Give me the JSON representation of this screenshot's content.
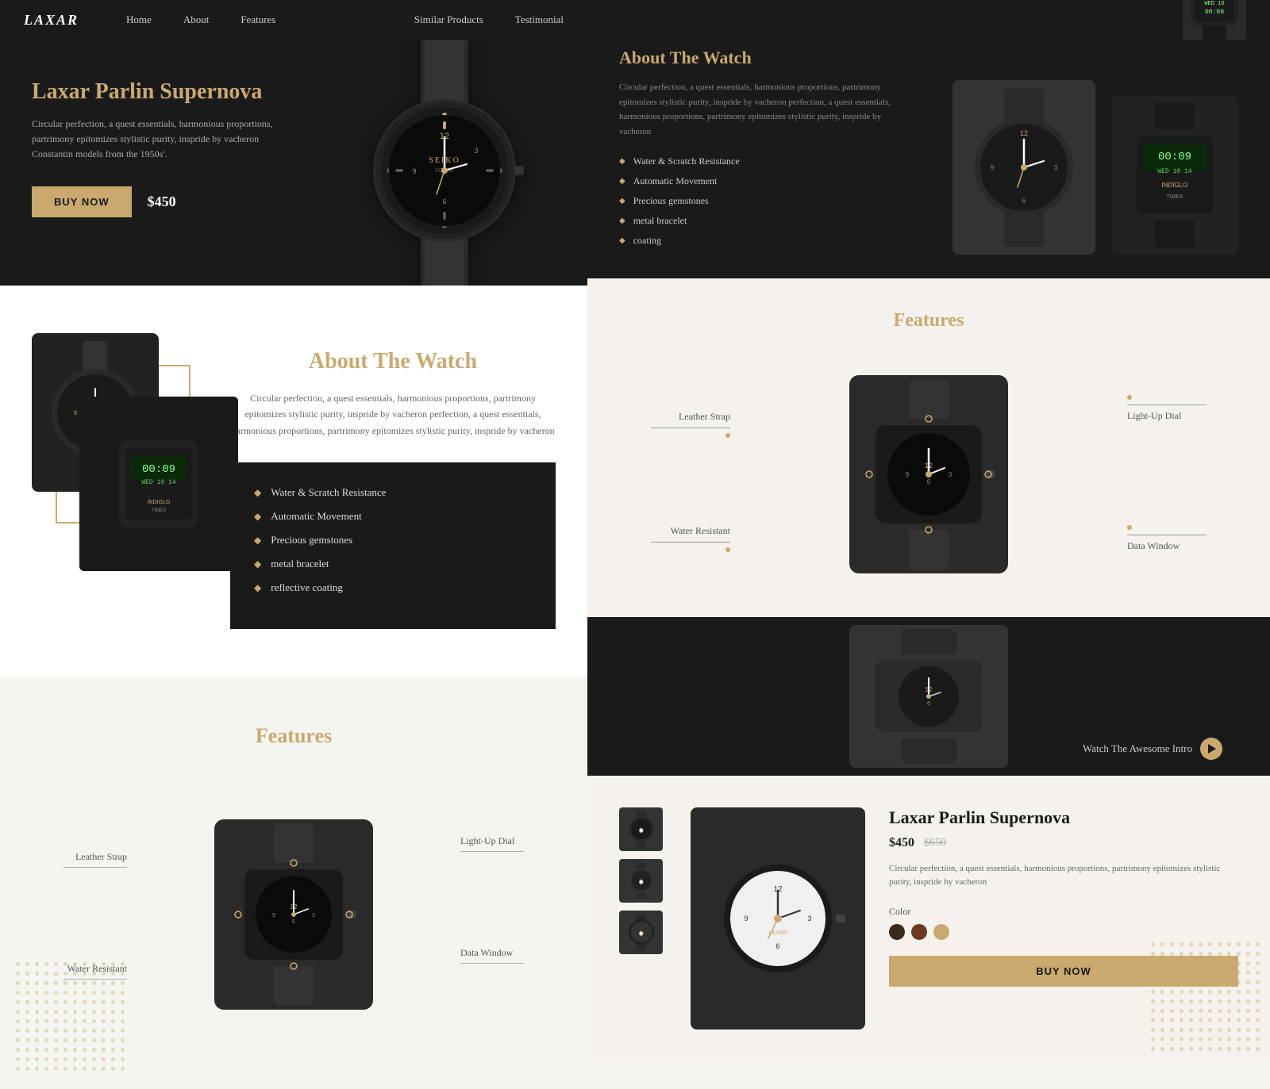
{
  "brand": {
    "name": "LA",
    "name_italic": "X",
    "name_rest": "AR"
  },
  "nav": {
    "links": [
      "Home",
      "About",
      "Features",
      "Similar Products",
      "Testimonial"
    ]
  },
  "hero": {
    "title": "Laxar Parlin Supernova",
    "description": "Circular perfection, a quest essentials, harmonious proportions, partrimony epitomizes stylistic purity, inspride by vacheron Constantin models from the 1950s'.",
    "buy_label": "BUY NOW",
    "price": "$450"
  },
  "about": {
    "title": "About The Watch",
    "description": "Circular perfection, a quest essentials, harmonious proportions, partrimony epitomizes stylistic purity, inspride by vacheron perfection, a quest essentials, harmonious proportions, partrimony epitomizes stylistic purity, inspride by vacheron"
  },
  "features_list": [
    "Water & Scratch Resistance",
    "Automatic Movement",
    "Precious gemstones",
    "metal bracelet",
    "reflective coating"
  ],
  "features": {
    "title": "Features",
    "labels": {
      "leather_strap": "Leather Strap",
      "light_up_dial": "Light-Up Dial",
      "water_resistant": "Water Resistant",
      "data_window": "Data Window"
    }
  },
  "right": {
    "about_title": "About The Watch",
    "about_desc": "Circular perfection, a quest essentials, harmonious proportions, partrimony epitomizes stylistic purity, inspride by vacheron perfection, a quest essentials, harmonious proportions, partrimony epitomizes stylistic purity, inspride by vacheron",
    "features_title": "Features",
    "features_labels": {
      "leather_strap": "Leather Strap",
      "light_up_dial": "Light-Up Dial",
      "water_resistant": "Water Resistant",
      "data_window": "Data Window"
    }
  },
  "video": {
    "label": "Watch The Awesome Intro"
  },
  "product": {
    "name": "Laxar Parlin Supernova",
    "price_new": "$450",
    "price_old": "$650",
    "description": "Circular perfection, a quest essentials, harmonious proportions, partrimony epitomizes stylistic purity, inspride by vacheron",
    "color_label": "Color",
    "buy_label": "BUY NOW"
  },
  "right_features_list": [
    "Water & Scratch Resistance",
    "Automatic Movement",
    "Precious gemstones",
    "metal bracelet",
    "reflective coating"
  ],
  "right_feature_label_coating": "coating"
}
